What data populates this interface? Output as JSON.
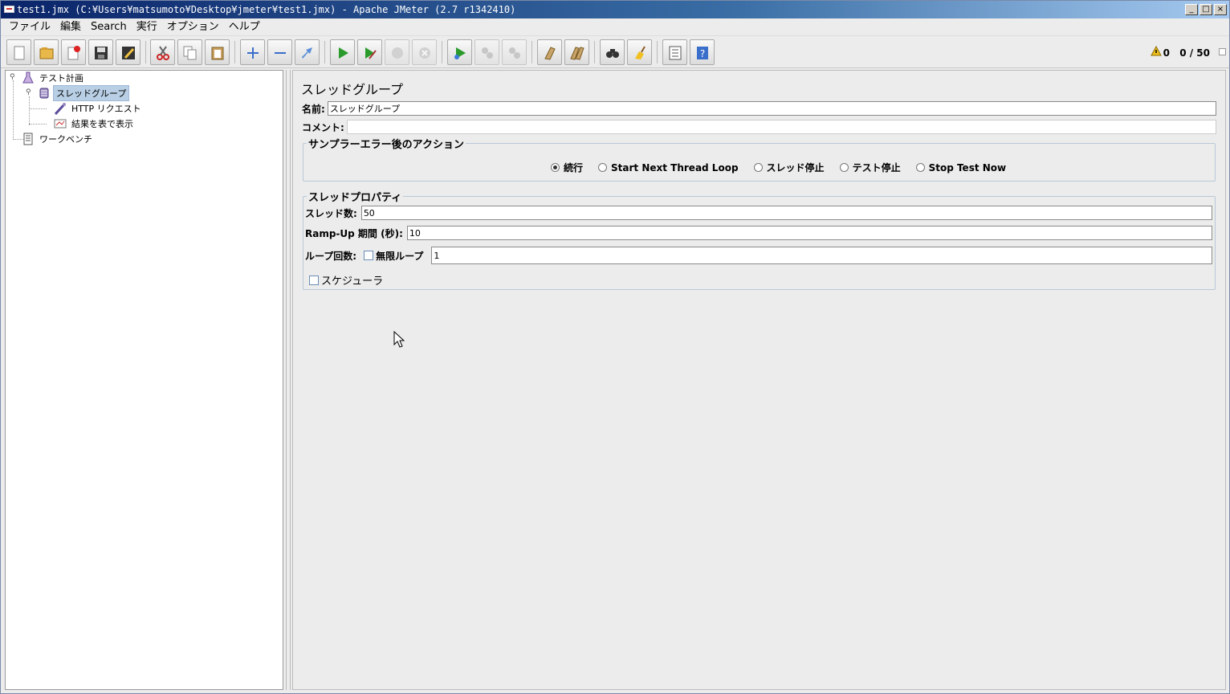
{
  "window": {
    "title": "test1.jmx (C:¥Users¥matsumoto¥Desktop¥jmeter¥test1.jmx) - Apache JMeter (2.7 r1342410)",
    "controls": {
      "minimize": "_",
      "maximize": "□",
      "close": "×"
    }
  },
  "menu": {
    "items": [
      "ファイル",
      "編集",
      "Search",
      "実行",
      "オプション",
      "ヘルプ"
    ]
  },
  "toolbar": {
    "buttons": [
      "new-icon",
      "open-icon",
      "close-file-icon",
      "save-icon",
      "save-as-icon",
      "cut-icon",
      "copy-icon",
      "paste-icon",
      "expand-icon",
      "collapse-icon",
      "toggle-icon",
      "start-icon",
      "start-no-timers-icon",
      "stop-icon",
      "shutdown-icon",
      "remote-start-icon",
      "remote-stop-icon",
      "remote-shutdown-icon",
      "clear-icon",
      "clear-all-icon",
      "search-icon",
      "reset-search-icon",
      "function-helper-icon",
      "help-icon"
    ],
    "error_count": "0",
    "thread_status": "0 / 50"
  },
  "tree": {
    "items": [
      {
        "label": "テスト計画",
        "icon": "test-plan-icon"
      },
      {
        "label": "スレッドグループ",
        "icon": "thread-group-icon",
        "selected": true
      },
      {
        "label": "HTTP リクエスト",
        "icon": "http-sampler-icon"
      },
      {
        "label": "結果を表で表示",
        "icon": "results-table-icon"
      },
      {
        "label": "ワークベンチ",
        "icon": "workbench-icon"
      }
    ]
  },
  "panel": {
    "title": "スレッドグループ",
    "name_label": "名前:",
    "name_value": "スレッドグループ",
    "comment_label": "コメント:",
    "comment_value": "",
    "error_action": {
      "legend": "サンプラーエラー後のアクション",
      "options": [
        "続行",
        "Start Next Thread Loop",
        "スレッド停止",
        "テスト停止",
        "Stop Test Now"
      ],
      "selected": "続行"
    },
    "thread_props": {
      "legend": "スレッドプロパティ",
      "threads_label": "スレッド数:",
      "threads_value": "50",
      "rampup_label": "Ramp-Up 期間 (秒):",
      "rampup_value": "10",
      "loop_label": "ループ回数:",
      "infinite_label": "無限ループ",
      "infinite_checked": false,
      "loop_value": "1",
      "scheduler_label": "スケジューラ",
      "scheduler_checked": false
    }
  }
}
